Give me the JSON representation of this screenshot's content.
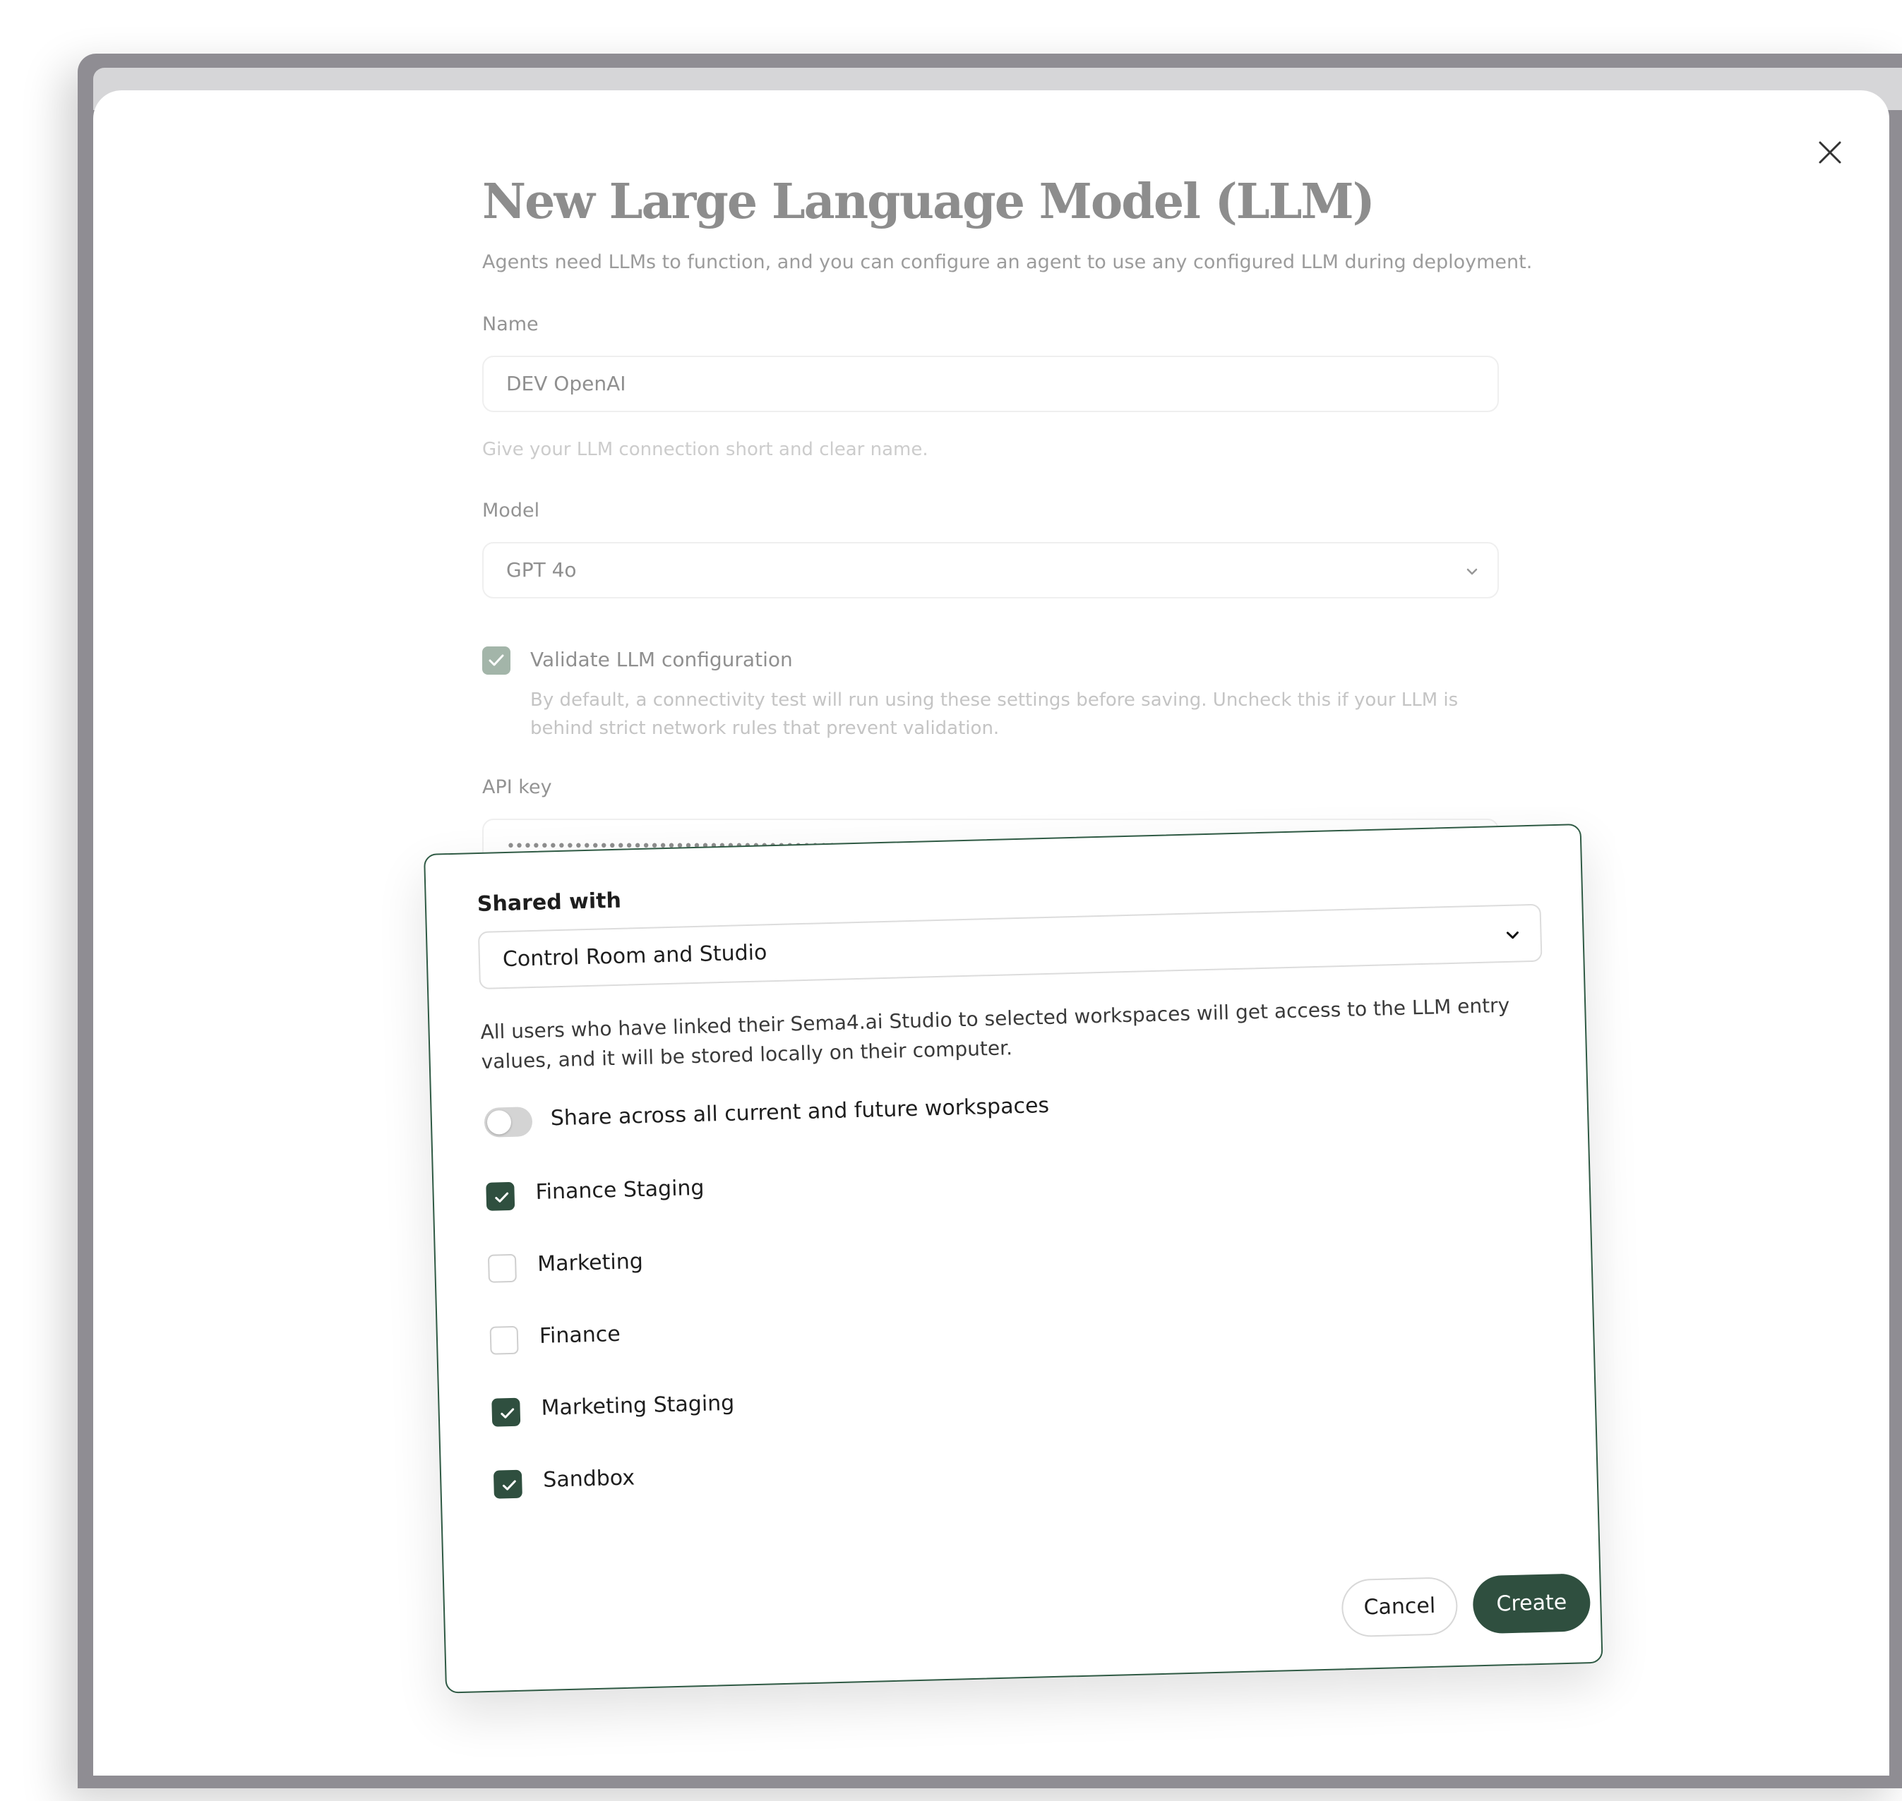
{
  "dialog": {
    "title": "New Large Language Model (LLM)",
    "subtitle": "Agents need LLMs to function, and you can configure an agent to use any configured LLM during deployment."
  },
  "name_field": {
    "label": "Name",
    "value": "DEV OpenAI",
    "hint": "Give your LLM connection short and clear name."
  },
  "model_field": {
    "label": "Model",
    "value": "GPT 4o"
  },
  "validate": {
    "checked": true,
    "label": "Validate LLM configuration",
    "description": "By default, a connectivity test will run using these settings before saving. Uncheck this if your LLM is behind strict network rules that prevent validation."
  },
  "api_key": {
    "label": "API key",
    "value": "••••••••••••••••••••••••••••••••••••••••••••••"
  },
  "share": {
    "label": "Shared with",
    "selected": "Control Room and Studio",
    "description": "All users who have linked their Sema4.ai Studio to selected workspaces will get access to the LLM entry values, and it will be stored locally on their computer.",
    "toggle_label": "Share across all current and future workspaces",
    "toggle_on": false,
    "workspaces": [
      {
        "name": "Finance Staging",
        "checked": true
      },
      {
        "name": "Marketing",
        "checked": false
      },
      {
        "name": "Finance",
        "checked": false
      },
      {
        "name": "Marketing Staging",
        "checked": true
      },
      {
        "name": "Sandbox",
        "checked": true
      }
    ]
  },
  "actions": {
    "cancel": "Cancel",
    "create": "Create"
  },
  "colors": {
    "accent": "#2f4f3f",
    "frame": "#8f8d93"
  }
}
